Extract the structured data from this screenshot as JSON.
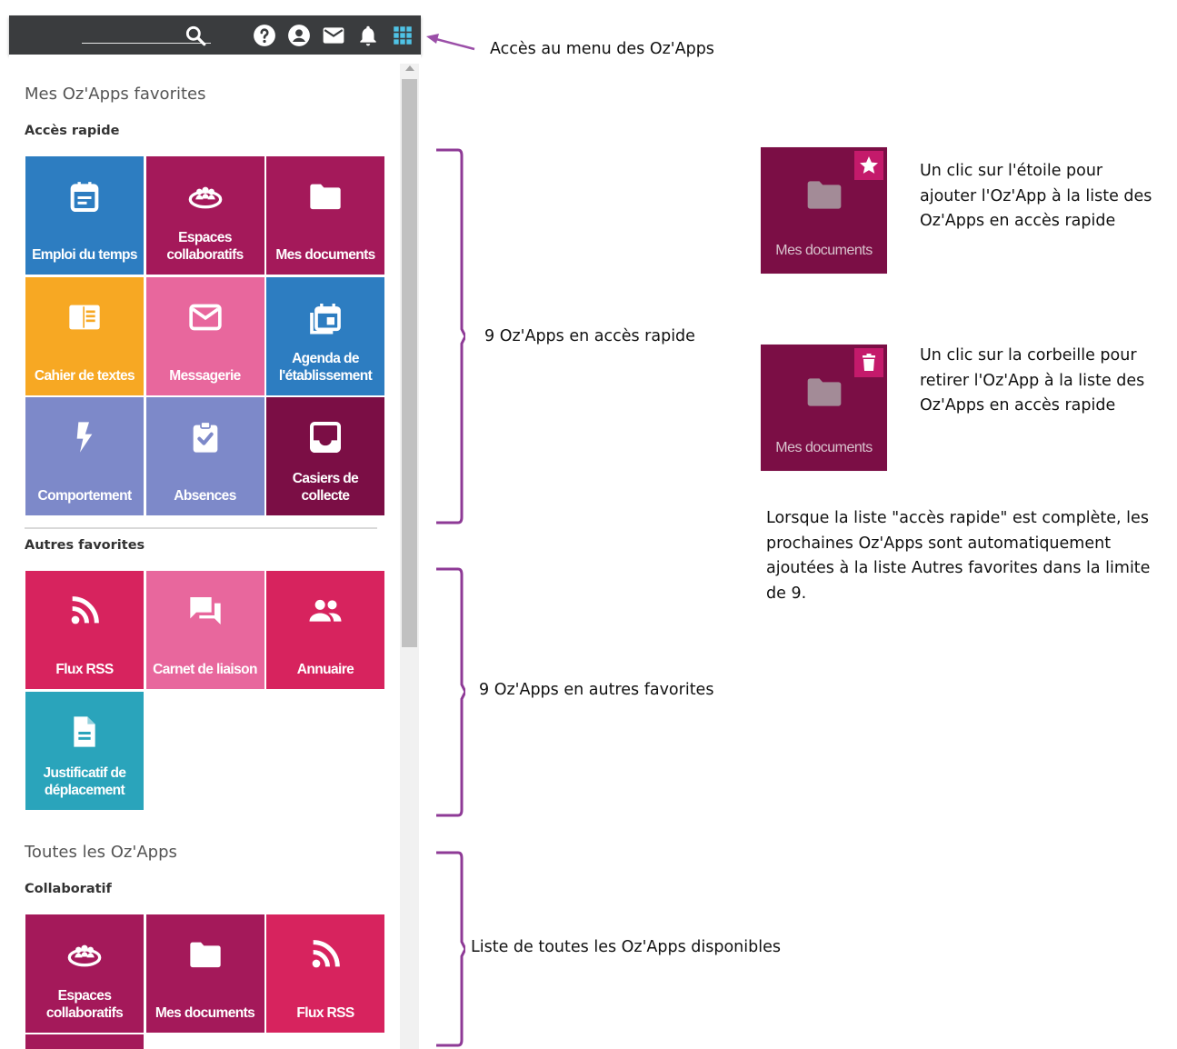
{
  "topbar": {
    "icons": [
      "search-icon",
      "help-icon",
      "account-icon",
      "mail-icon",
      "bell-icon",
      "apps-grid-icon"
    ],
    "icon_color": "#ffffff",
    "apps_icon_color": "#4fc3e6",
    "background": "#3a3c3e"
  },
  "panel": {
    "favorites_title": "Mes Oz'Apps favorites",
    "quick_access_label": "Accès rapide",
    "other_favorites_label": "Autres favorites",
    "all_apps_title": "Toutes les Oz'Apps",
    "collaborative_label": "Collaboratif"
  },
  "quick_access": [
    {
      "label": "Emploi du temps",
      "icon": "calendar-icon",
      "color": "#2d7dc1"
    },
    {
      "label": "Espaces\ncollaboratifs",
      "icon": "group-icon",
      "color": "#a4195a"
    },
    {
      "label": "Mes documents",
      "icon": "folder-icon",
      "color": "#a4195a"
    },
    {
      "label": "Cahier de textes",
      "icon": "textbook-icon",
      "color": "#f7a823"
    },
    {
      "label": "Messagerie",
      "icon": "mail-icon",
      "color": "#e8679d"
    },
    {
      "label": "Agenda de\nl'établissement",
      "icon": "event-calendar-icon",
      "color": "#2d7dc1"
    },
    {
      "label": "Comportement",
      "icon": "lightning-icon",
      "color": "#7d89c9"
    },
    {
      "label": "Absences",
      "icon": "clipboard-check-icon",
      "color": "#7d89c9"
    },
    {
      "label": "Casiers de\ncollecte",
      "icon": "inbox-icon",
      "color": "#7b0e45"
    }
  ],
  "other_favorites": [
    {
      "label": "Flux RSS",
      "icon": "rss-icon",
      "color": "#d7235e"
    },
    {
      "label": "Carnet de liaison",
      "icon": "chat-icon",
      "color": "#e8679d"
    },
    {
      "label": "Annuaire",
      "icon": "people-icon",
      "color": "#d7235e"
    },
    {
      "label": "Justificatif de\ndéplacement",
      "icon": "document-icon",
      "color": "#2aa4bb"
    }
  ],
  "collaborative": [
    {
      "label": "Espaces\ncollaboratifs",
      "icon": "group-icon",
      "color": "#a4195a"
    },
    {
      "label": "Mes documents",
      "icon": "folder-icon",
      "color": "#a4195a"
    },
    {
      "label": "Flux RSS",
      "icon": "rss-icon",
      "color": "#d7235e"
    }
  ],
  "annotations": {
    "menu_access": "Accès au menu des Oz'Apps",
    "quick_access_count": "9 Oz'Apps en accès rapide",
    "other_favorites_count": "9 Oz'Apps en autres favorites",
    "all_apps_list": "Liste de toutes les Oz'Apps disponibles",
    "star_help": "Un clic sur l'étoile pour\najouter l'Oz'App à la liste des\nOz'Apps en accès rapide",
    "trash_help": "Un clic sur la corbeille pour\nretirer l'Oz'App à la liste des\nOz'Apps en accès rapide",
    "full_list_help": "Lorsque la liste \"accès rapide\" est complète, les\nprochaines Oz'Apps sont automatiquement\najoutées à la liste Autres favorites dans la limite\nde 9.",
    "demo_tile_label": "Mes documents",
    "demo_star_icon": "star-icon",
    "demo_trash_icon": "trash-icon",
    "arrow_color": "#9b4fa8",
    "brace_color": "#8e3a96"
  }
}
